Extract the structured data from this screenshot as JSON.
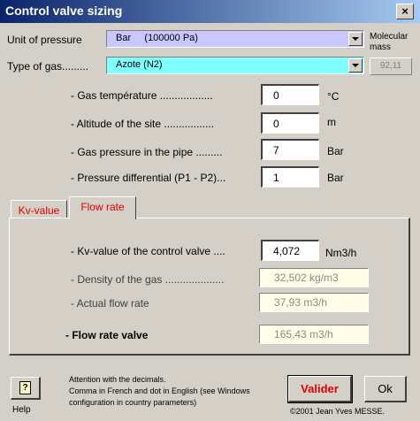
{
  "window": {
    "title": "Control valve sizing",
    "close_label": "×"
  },
  "pressure": {
    "label": "Unit of pressure",
    "unit_value": "Bar",
    "unit_detail": "(100000 Pa)",
    "color": "#c8c8ff"
  },
  "gas": {
    "label": "Type of gas.........",
    "value": "Azote (N2)",
    "color": "#80ffff"
  },
  "molecular_mass": {
    "label_line1": "Molecular",
    "label_line2": "mass",
    "value": "92,11"
  },
  "fields": [
    {
      "label": "- Gas température ..................",
      "value": "0",
      "unit": "°C"
    },
    {
      "label": "- Altitude of the site .................",
      "value": "0",
      "unit": "m"
    },
    {
      "label": "- Gas pressure in the pipe .........",
      "value": "7",
      "unit": "Bar"
    },
    {
      "label": "- Pressure differential (P1 - P2)...",
      "value": "1",
      "unit": "Bar"
    }
  ],
  "tabs": [
    {
      "label": "Kv-value"
    },
    {
      "label": "Flow rate"
    }
  ],
  "flow": {
    "kv_label": "- Kv-value of the control valve ....",
    "kv_value": "4,072",
    "kv_unit": "Nm3/h",
    "density_label": "- Density of the gas ....................",
    "density_value": "32,502 kg/m3",
    "actual_label": "- Actual flow rate",
    "actual_value": "37,93 m3/h",
    "valve_label": "- Flow rate valve",
    "valve_value": "165,43 m3/h"
  },
  "footer": {
    "help_label": "Help",
    "note_line1": "Attention with the decimals.",
    "note_line2": "Comma in French and dot in English (see Windows",
    "note_line3": "configuration in country parameters)",
    "validate_label": "Valider",
    "ok_label": "Ok",
    "copyright": "©2001 Jean Yves MESSE."
  }
}
